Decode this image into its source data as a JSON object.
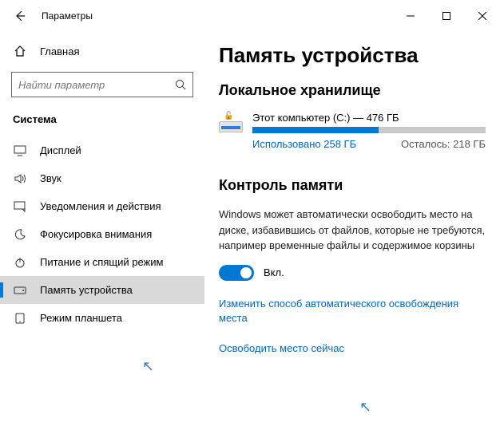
{
  "window": {
    "title": "Параметры"
  },
  "sidebar": {
    "home": "Главная",
    "search_placeholder": "Найти параметр",
    "section": "Система",
    "items": [
      {
        "label": "Дисплей",
        "icon": "display"
      },
      {
        "label": "Звук",
        "icon": "sound"
      },
      {
        "label": "Уведомления и действия",
        "icon": "notifications"
      },
      {
        "label": "Фокусировка внимания",
        "icon": "moon"
      },
      {
        "label": "Питание и спящий режим",
        "icon": "power"
      },
      {
        "label": "Память устройства",
        "icon": "storage",
        "selected": true
      },
      {
        "label": "Режим планшета",
        "icon": "tablet"
      }
    ]
  },
  "main": {
    "title": "Память устройства",
    "local_storage": "Локальное хранилище",
    "drive": {
      "name": "Этот компьютер (C:) — 476 ГБ",
      "used_pct": 54,
      "used_label": "Использовано 258 ГБ",
      "free_label": "Осталось: 218 ГБ"
    },
    "sense_heading": "Контроль памяти",
    "sense_desc": "Windows может автоматически освободить место на диске, избавившись от файлов, которые не требуются, например временные файлы и содержимое корзины",
    "toggle_label": "Вкл.",
    "link_change": "Изменить способ автоматического освобождения места",
    "link_free": "Освободить место сейчас"
  }
}
